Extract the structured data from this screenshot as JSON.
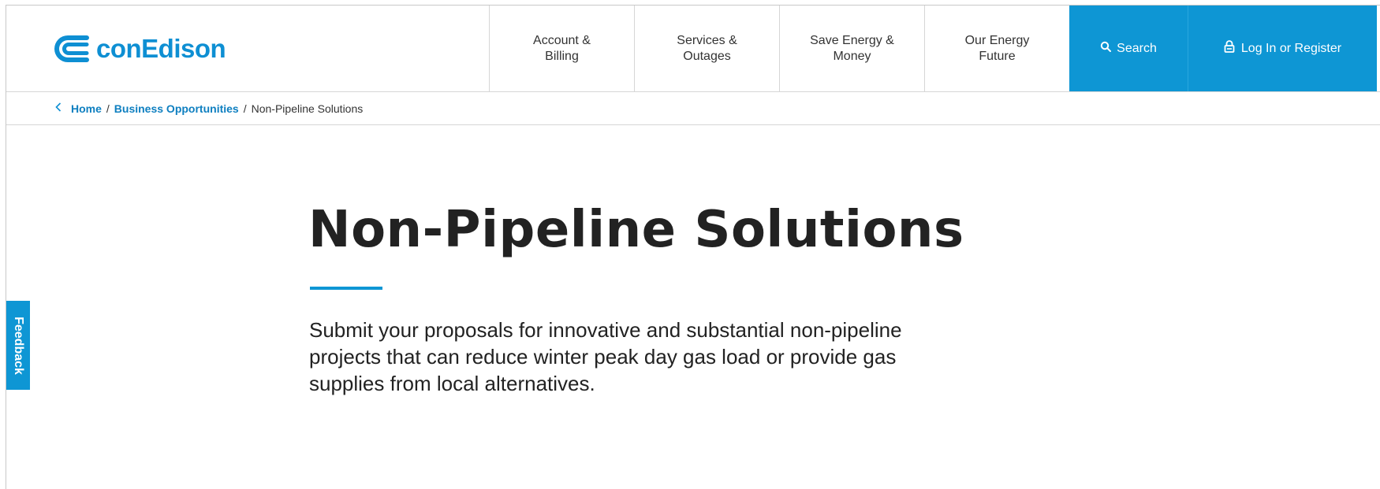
{
  "brand": {
    "logo_text": "conEdison",
    "logo_icon": "con-edison-logo-icon",
    "accent_color": "#0e96d4"
  },
  "nav": {
    "items": [
      {
        "label": "Account &\nBilling"
      },
      {
        "label": "Services &\nOutages"
      },
      {
        "label": "Save Energy &\nMoney"
      },
      {
        "label": "Our Energy\nFuture"
      }
    ],
    "search_label": "Search",
    "search_icon": "search-icon",
    "login_label": "Log In or Register",
    "login_icon": "lock-icon"
  },
  "breadcrumb": {
    "back_icon": "chevron-left-icon",
    "items": [
      {
        "label": "Home"
      },
      {
        "label": "Business Opportunities"
      }
    ],
    "separator": "/",
    "current": "Non-Pipeline Solutions"
  },
  "main": {
    "title": "Non-Pipeline Solutions",
    "lead": "Submit your proposals for innovative and substantial non-pipeline projects that can reduce winter peak day gas load or provide gas supplies from local alternatives."
  },
  "feedback": {
    "label": "Feedback"
  }
}
